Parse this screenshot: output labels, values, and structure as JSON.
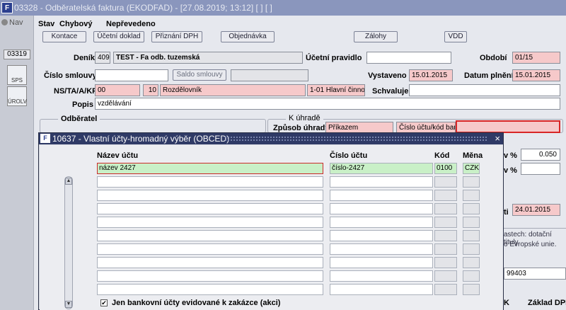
{
  "window": {
    "title": "03328 - Odběratelská faktura (EKODFAD) - [27.08.2019; 13:12] [ ] [ ]",
    "logo_glyph": "F"
  },
  "left": {
    "nav_label": "Nav",
    "badge": "03319",
    "icon1_label": "SPS",
    "icon2_label": "ÚROLV"
  },
  "header": {
    "stav_label": "Stav",
    "stav_value": "Chybový",
    "posted_value": "Nepřevedeno"
  },
  "toolbar": {
    "kontace": "Kontace",
    "ucetni_doklad": "Účetní doklad",
    "priznani_dph": "Přiznání DPH",
    "objednavka": "Objednávka",
    "zalohy": "Zálohy",
    "vdd": "VDD"
  },
  "form": {
    "denik_label": "Deník",
    "denik_code": "409",
    "denik_name": "TEST - Fa odb. tuzemská",
    "ucetni_pravidlo_label": "Účetní pravidlo",
    "ucetni_pravidlo_value": "",
    "obdobi_label": "Období",
    "obdobi_value": "01/15",
    "cislo_smlouvy_label": "Číslo smlouvy",
    "cislo_smlouvy_value": "",
    "saldo_smlouvy": "Saldo smlouvy",
    "vystaveno_label": "Vystaveno",
    "vystaveno_value": "15.01.2015",
    "datum_plneni_label": "Datum plnění",
    "datum_plneni_value": "15.01.2015",
    "ns_label": "NS/TA/A/KP",
    "ns_value": "00",
    "ta_value": "10",
    "ta_name": "Rozdělovník",
    "kp_value": "1-01 Hlavní činnost",
    "schvaluje_label": "Schvaluje",
    "schvaluje_value": "",
    "popis_label": "Popis",
    "popis_value": "vzdělávání",
    "odberatel_title": "Odběratel",
    "k_uhrade_title": "K úhradě",
    "zpusob_uhrady_label": "Způsob úhrady",
    "zpusob_uhrady_value": "Příkazem",
    "cislo_uctu_kod_banky": "Číslo účtu/kód banky",
    "bank_value": "",
    "pct1_label": "v %",
    "pct1_value": "0.050",
    "pct2_label": "v %",
    "pct2_value": "",
    "date_label": "ti",
    "date_value": "24.01.2015",
    "note_text1": "astech: dotační tituly,",
    "note_text2": "o Evropské unie.",
    "id_value": "99403",
    "footer_k": "K",
    "footer_zaklad": "Základ DPH"
  },
  "dialog": {
    "title": "10637 - Vlastní účty-hromadný výběr (OBCED)",
    "close_glyph": "×",
    "col_nazev": "Název účtu",
    "col_cislo": "Číslo účtu",
    "col_kod": "Kód",
    "col_mena": "Měna",
    "rows": [
      {
        "nazev": "název 2427",
        "cislo": "číslo-2427",
        "kod": "0100",
        "mena": "CZK"
      },
      {
        "nazev": "",
        "cislo": "",
        "kod": "",
        "mena": ""
      },
      {
        "nazev": "",
        "cislo": "",
        "kod": "",
        "mena": ""
      },
      {
        "nazev": "",
        "cislo": "",
        "kod": "",
        "mena": ""
      },
      {
        "nazev": "",
        "cislo": "",
        "kod": "",
        "mena": ""
      },
      {
        "nazev": "",
        "cislo": "",
        "kod": "",
        "mena": ""
      },
      {
        "nazev": "",
        "cislo": "",
        "kod": "",
        "mena": ""
      },
      {
        "nazev": "",
        "cislo": "",
        "kod": "",
        "mena": ""
      },
      {
        "nazev": "",
        "cislo": "",
        "kod": "",
        "mena": ""
      },
      {
        "nazev": "",
        "cislo": "",
        "kod": "",
        "mena": ""
      }
    ],
    "checkbox_label": "Jen bankovní účty evidované k zakázce (akci)",
    "checkbox_checked": true,
    "check_glyph": "✔"
  },
  "colors": {
    "pink": "#f6c9ca",
    "selected": "#c9f0c7",
    "dialog_title": "#2f3a66",
    "highlight_red": "#d82626"
  }
}
